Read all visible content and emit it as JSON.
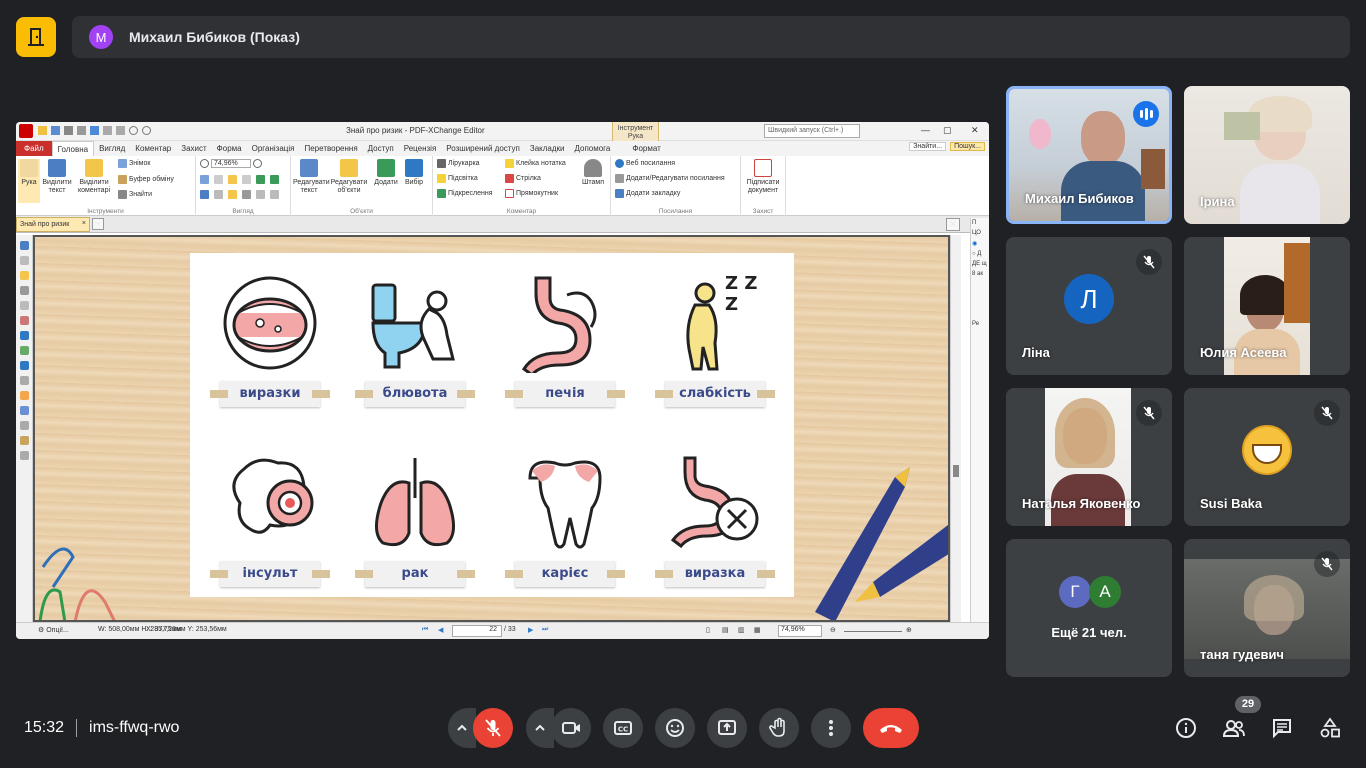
{
  "presenter": {
    "initial": "M",
    "name": "Михаил Бибиков (Показ)"
  },
  "app": {
    "title": "Знай про ризик - PDF-XChange Editor",
    "quick_search": "Швидкий запуск (Ctrl+.)",
    "context_tab": "Інструмент Рука",
    "context_subtab": "Формат",
    "tabs": [
      "Файл",
      "Головна",
      "Вигляд",
      "Коментар",
      "Захист",
      "Форма",
      "Організація",
      "Перетворення",
      "Доступ",
      "Рецензія",
      "Розширений доступ",
      "Закладки",
      "Допомога"
    ],
    "right_tools": [
      "Знайти...",
      "Пошук..."
    ],
    "groups": {
      "tools": "Інструменти",
      "view": "Вигляд",
      "objects": "Об'єкти",
      "comment": "Коментар",
      "links": "Посилання",
      "protect": "Захист"
    },
    "buttons": {
      "hand": "Рука",
      "select_text": "Виділити текст",
      "select_comments": "Виділити коментарі",
      "snapshot": "Знімок",
      "clipboard": "Буфер обміну",
      "find": "Знайти",
      "zoom": "74,96%",
      "edit_text": "Редагувати текст",
      "edit_objects": "Редагувати об'єкти",
      "add": "Додати",
      "select": "Вибір",
      "pencil": "Лірукарка",
      "highlight": "Підсвітка",
      "underline": "Підкреслення",
      "sticky": "Клейка нотатка",
      "arrow": "Стрілка",
      "rectangle": "Прямокутник",
      "stamp": "Штамп",
      "web_links": "Веб посилання",
      "add_edit_links": "Додати/Редагувати посилання",
      "add_bookmark": "Додати закладку",
      "sign": "Підписати документ"
    },
    "doc_tab": "Знай про ризик",
    "status": {
      "options": "Опції...",
      "dims": "W: 508,00мм  H: 285,75мм",
      "coords": "X: 377,21мм  Y: 253,56мм",
      "page": "22",
      "pages": "/ 33",
      "zoom": "74,96%"
    },
    "right_pane": [
      "П",
      "ЦО",
      "Д",
      "ДЕ щ",
      "8 ак",
      "Ре"
    ]
  },
  "slide": {
    "labels": [
      "виразки",
      "блювота",
      "печія",
      "слабкість",
      "інсульт",
      "рак",
      "карієс",
      "виразка"
    ],
    "zzz": "Z Z Z"
  },
  "participants": [
    {
      "name": "Михаил Бибиков",
      "speaking": true
    },
    {
      "name": "Ірина"
    },
    {
      "name": "Ліна",
      "initial": "Л",
      "muted": true,
      "color": "#1565c0"
    },
    {
      "name": "Юлия Асеева"
    },
    {
      "name": "Наталья Яковенко",
      "muted": true
    },
    {
      "name": "Susi Baka",
      "muted": true
    },
    {
      "more_label": "Ещё 21 чел.",
      "initials": [
        "Г",
        "А"
      ],
      "colors": [
        "#5c6bc0",
        "#2e7d32"
      ]
    },
    {
      "name": "таня гудевич",
      "muted": true
    }
  ],
  "bottom": {
    "time": "15:32",
    "meeting_code": "ims-ffwq-rwo",
    "participants_count": "29"
  },
  "colors": {
    "accent": "#fbbc04",
    "end_call": "#ea4335",
    "mic_off": "#ea4335",
    "speaking": "#1a73e8"
  }
}
